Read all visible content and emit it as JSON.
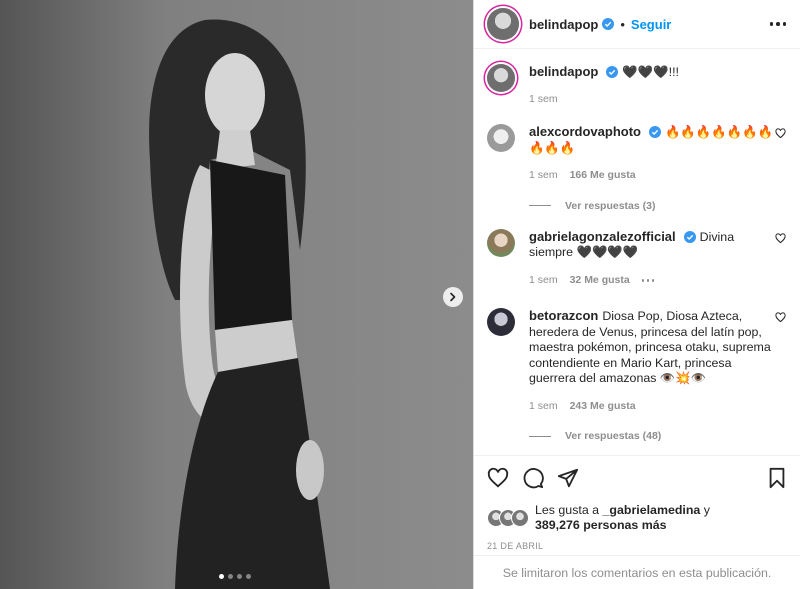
{
  "header": {
    "username": "belindapop",
    "separator": "•",
    "follow_label": "Seguir"
  },
  "caption": {
    "username": "belindapop",
    "text": "🖤🖤🖤!!!",
    "time": "1 sem"
  },
  "comments": [
    {
      "username": "alexcordovaphoto",
      "verified": true,
      "text": "🔥🔥🔥🔥🔥🔥🔥🔥🔥🔥",
      "time": "1 sem",
      "likes": "166 Me gusta",
      "replies": "Ver respuestas (3)"
    },
    {
      "username": "gabrielagonzalezofficial",
      "verified": true,
      "text": "Divina siempre 🖤🖤🖤🖤",
      "time": "1 sem",
      "likes": "32 Me gusta"
    },
    {
      "username": "betorazcon",
      "verified": false,
      "text": "Diosa Pop, Diosa Azteca, heredera de Venus, princesa del latín pop, maestra pokémon, princesa otaku, suprema contendiente en Mario Kart, princesa guerrera del amazonas 👁️💥👁️",
      "time": "1 sem",
      "likes": "243 Me gusta",
      "replies": "Ver respuestas (48)"
    }
  ],
  "likes": {
    "prefix": "Les gusta a",
    "user": "_gabrielamedina",
    "connector": "y",
    "count": "389,276 personas más"
  },
  "date": "21 DE ABRIL",
  "footer": "Se limitaron los comentarios en esta publicación.",
  "carousel": {
    "total_slides": 4,
    "active_slide": 1
  },
  "colors": {
    "accent": "#0095f6",
    "text": "#262626",
    "muted": "#8e8e8e",
    "verified": "#3897f0"
  },
  "icons": [
    "verified-badge-icon",
    "more-options-icon",
    "heart-icon",
    "comment-icon",
    "share-icon",
    "bookmark-icon",
    "chevron-right-icon"
  ]
}
